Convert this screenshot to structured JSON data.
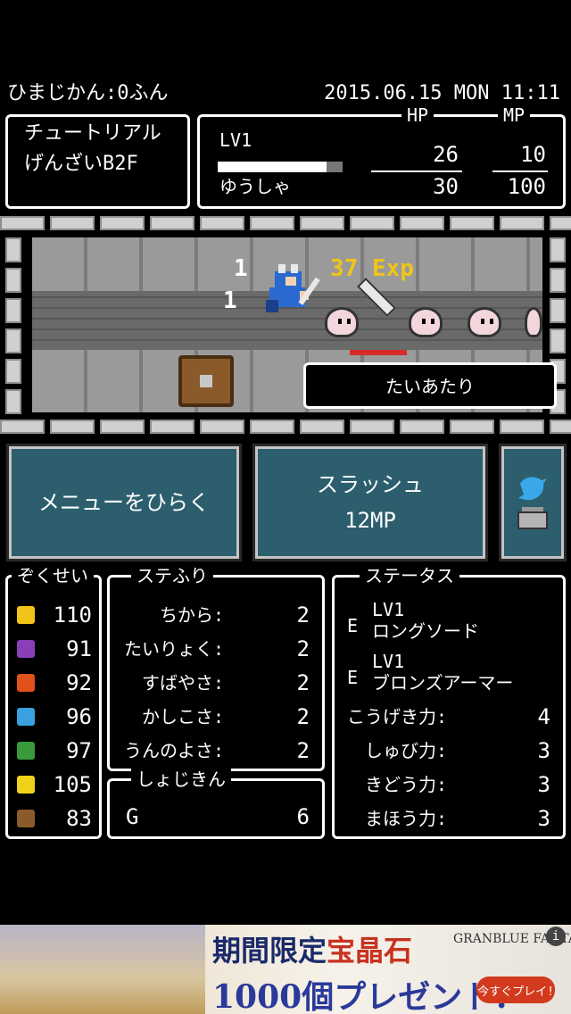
{
  "header": {
    "play_time": "ひまじかん:0ふん",
    "datetime": "2015.06.15 MON 11:11"
  },
  "location": {
    "line1": "チュートリアル",
    "line2": "げんざいB2F"
  },
  "player": {
    "level": "LV1",
    "name": "ゆうしゃ",
    "hp_label": "HP",
    "mp_label": "MP",
    "hp_current": "26",
    "hp_max": "30",
    "mp_current": "10",
    "mp_max": "100",
    "hp_fraction": 0.87
  },
  "battle": {
    "damage1": "1",
    "damage2": "1",
    "exp": "37 Exp",
    "action": "たいあたり"
  },
  "buttons": {
    "menu": "メニューをひらく",
    "skill_name": "スラッシュ",
    "skill_cost": "12MP"
  },
  "attributes": {
    "title": "ぞくせい",
    "items": [
      {
        "icon": "light-icon",
        "value": "110",
        "color": "#f0c418"
      },
      {
        "icon": "dark-icon",
        "value": "91",
        "color": "#8a3fb8"
      },
      {
        "icon": "fire-icon",
        "value": "92",
        "color": "#e2501c"
      },
      {
        "icon": "water-icon",
        "value": "96",
        "color": "#3aa0e0"
      },
      {
        "icon": "wood-icon",
        "value": "97",
        "color": "#3a9a3a"
      },
      {
        "icon": "thunder-icon",
        "value": "105",
        "color": "#f0d21a"
      },
      {
        "icon": "earth-icon",
        "value": "83",
        "color": "#8b5a2b"
      }
    ]
  },
  "stat_alloc": {
    "title": "ステふり",
    "items": [
      {
        "label": "ちから:",
        "value": "2"
      },
      {
        "label": "たいりょく:",
        "value": "2"
      },
      {
        "label": "すばやさ:",
        "value": "2"
      },
      {
        "label": "かしこさ:",
        "value": "2"
      },
      {
        "label": "うんのよさ:",
        "value": "2"
      }
    ]
  },
  "gold": {
    "title": "しょじきん",
    "label": "G",
    "value": "6"
  },
  "status": {
    "title": "ステータス",
    "equip": [
      {
        "mark": "E",
        "level": "LV1",
        "name": "ロングソード"
      },
      {
        "mark": "E",
        "level": "LV1",
        "name": "ブロンズアーマー"
      }
    ],
    "items": [
      {
        "label": "こうげき力:",
        "value": "4"
      },
      {
        "label": "しゅび力:",
        "value": "3"
      },
      {
        "label": "きどう力:",
        "value": "3"
      },
      {
        "label": "まほう力:",
        "value": "3"
      }
    ]
  },
  "ad": {
    "headline_a": "期間限定",
    "headline_b": "宝晶石",
    "sub": "1000個プレゼント!",
    "brand": "GRANBLUE FANTAS",
    "cta": "今すぐプレイ!",
    "info": "i"
  }
}
